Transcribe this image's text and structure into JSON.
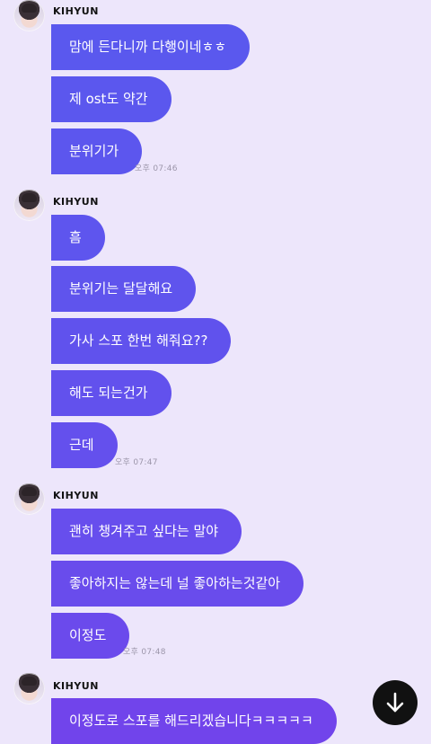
{
  "theme": {
    "background": "#ede6fb",
    "bubble_colors": [
      "#5a58ee",
      "#5f54ed",
      "#6650ed",
      "#6c4aec",
      "#7144eb"
    ]
  },
  "groups": [
    {
      "sender": "KIHYUN",
      "messages": [
        "맘에 든다니까 다행이네ㅎㅎ",
        "제 ost도 약간",
        "분위기가"
      ],
      "time": "오후 07:46"
    },
    {
      "sender": "KIHYUN",
      "messages": [
        "흠",
        "분위기는 달달해요",
        "가사 스포 한번 해줘요??",
        "해도 되는건가",
        "근데"
      ],
      "time": "오후 07:47"
    },
    {
      "sender": "KIHYUN",
      "messages": [
        "괜히 챙겨주고 싶다는 말야",
        "좋아하지는 않는데 널 좋아하는것같아",
        "이정도"
      ],
      "time": "오후 07:48"
    },
    {
      "sender": "KIHYUN",
      "messages": [
        "이정도로 스포를 해드리겠습니다ㅋㅋㅋㅋㅋ"
      ],
      "time": ""
    }
  ],
  "scroll_button": {
    "icon": "arrow-down-icon"
  }
}
